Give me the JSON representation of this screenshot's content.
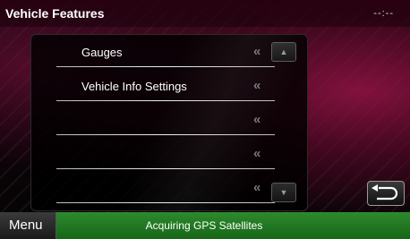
{
  "header": {
    "title": "Vehicle Features",
    "clock": "--:--"
  },
  "list": {
    "items": [
      {
        "label": "Gauges"
      },
      {
        "label": "Vehicle Info Settings"
      },
      {
        "label": ""
      },
      {
        "label": ""
      },
      {
        "label": ""
      }
    ],
    "chevron": "«",
    "scroll_up_icon": "▲",
    "scroll_down_icon": "▼"
  },
  "footer": {
    "menu_label": "Menu",
    "status": "Acquiring GPS Satellites"
  },
  "colors": {
    "status_bar": "#1f7a1f",
    "accent_background": "#8a1240"
  },
  "icons": {
    "back": "back-arrow-icon",
    "scroll_up": "up-triangle-icon",
    "scroll_down": "down-triangle-icon"
  }
}
